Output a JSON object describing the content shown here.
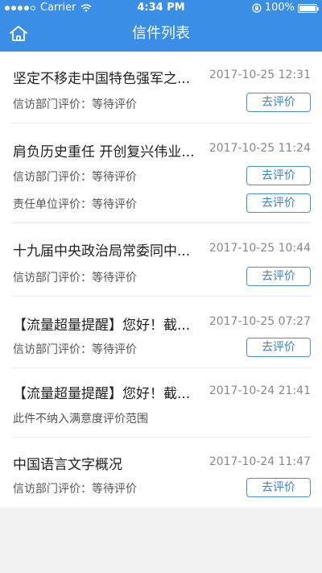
{
  "status": {
    "carrier": "Carrier",
    "time": "4:34 PM",
    "battery": "100%",
    "battery_level": 1.0
  },
  "nav": {
    "title": "信件列表",
    "home_icon": "home-icon"
  },
  "colors": {
    "header": "#3a8ee6",
    "button_border": "#4a90d9",
    "button_text": "#3a7fd0"
  },
  "letters": [
    {
      "title": "坚定不移走中国特色强军之...",
      "date": "2017-10-25 12:31",
      "evaluations": [
        {
          "label": "信访部门评价：等待评价",
          "button": "去评价"
        }
      ]
    },
    {
      "title": "肩负历史重任 开创复兴伟业...",
      "date": "2017-10-25 11:24",
      "evaluations": [
        {
          "label": "信访部门评价：等待评价",
          "button": "去评价"
        },
        {
          "label": "责任单位评价：等待评价",
          "button": "去评价"
        }
      ]
    },
    {
      "title": "十九届中央政治局常委同中...",
      "date": "2017-10-25 10:44",
      "evaluations": [
        {
          "label": "信访部门评价：等待评价",
          "button": "去评价"
        }
      ]
    },
    {
      "title": "【流量超量提醒】您好！截...",
      "date": "2017-10-25 07:27",
      "evaluations": [
        {
          "label": "信访部门评价：等待评价",
          "button": "去评价"
        }
      ]
    },
    {
      "title": "【流量超量提醒】您好！截...",
      "date": "2017-10-24 21:41",
      "note": "此件不纳入满意度评价范围"
    },
    {
      "title": "中国语言文字概况",
      "date": "2017-10-24 11:47",
      "evaluations": [
        {
          "label": "信访部门评价：等待评价",
          "button": "去评价"
        }
      ]
    }
  ]
}
